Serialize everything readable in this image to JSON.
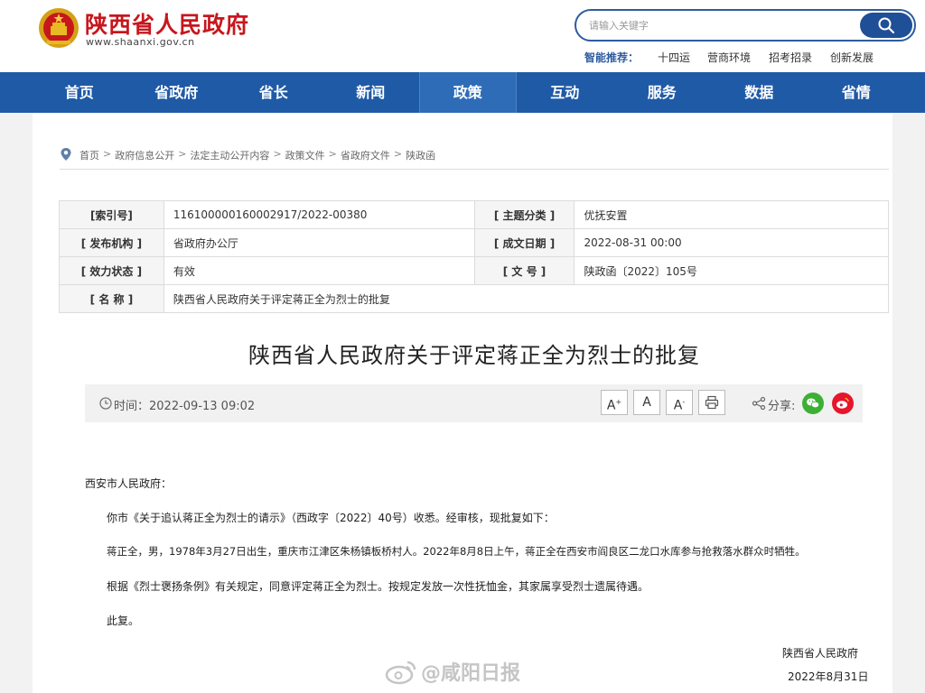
{
  "header": {
    "site_name": "陕西省人民政府",
    "site_url": "www.shaanxi.gov.cn",
    "search_placeholder": "请输入关键字",
    "hot_label": "智能推荐：",
    "hot_links": [
      "十四运",
      "营商环境",
      "招考招录",
      "创新发展"
    ]
  },
  "nav": [
    "首页",
    "省政府",
    "省长",
    "新闻",
    "政策",
    "互动",
    "服务",
    "数据",
    "省情"
  ],
  "breadcrumb": [
    "首页",
    "政府信息公开",
    "法定主动公开内容",
    "政策文件",
    "省政府文件",
    "陕政函"
  ],
  "breadcrumb_sep": ">",
  "info": {
    "index_label": "[索引号]",
    "index_value": "116100000160002917/2022-00380",
    "topic_label": "[ 主题分类 ]",
    "topic_value": "优抚安置",
    "issuer_label": "[ 发布机构 ]",
    "issuer_value": "省政府办公厅",
    "date_label": "[ 成文日期 ]",
    "date_value": "2022-08-31 00:00",
    "status_label": "[ 效力状态 ]",
    "status_value": "有效",
    "docno_label": "[ 文 号 ]",
    "docno_value": "陕政函〔2022〕105号",
    "name_label": "[ 名 称 ]",
    "name_value": "陕西省人民政府关于评定蒋正全为烈士的批复"
  },
  "doc_title": "陕西省人民政府关于评定蒋正全为烈士的批复",
  "meta": {
    "time_text": "时间：2022-09-13 09:02",
    "font_large": "A",
    "font_medium": "A",
    "font_small": "A",
    "share_label": "分享:"
  },
  "body": {
    "salutation": "西安市人民政府：",
    "p1": "你市《关于追认蒋正全为烈士的请示》（西政字〔2022〕40号）收悉。经审核，现批复如下：",
    "p2": "蒋正全，男，1978年3月27日出生，重庆市江津区朱杨镇板桥村人。2022年8月8日上午，蒋正全在西安市阎良区二龙口水库参与抢救落水群众时牺牲。",
    "p3": "根据《烈士褒扬条例》有关规定，同意评定蒋正全为烈士。按规定发放一次性抚恤金，其家属享受烈士遗属待遇。",
    "p4": "此复。",
    "signature": "陕西省人民政府",
    "sign_date": "2022年8月31日"
  },
  "watermark": "@咸阳日报",
  "colors": {
    "brand_red": "#c8161d",
    "nav_blue": "#1f5aa6",
    "nav_active": "#2e6cb8",
    "wechat_green": "#3cb034",
    "weibo_red": "#e6162d"
  }
}
